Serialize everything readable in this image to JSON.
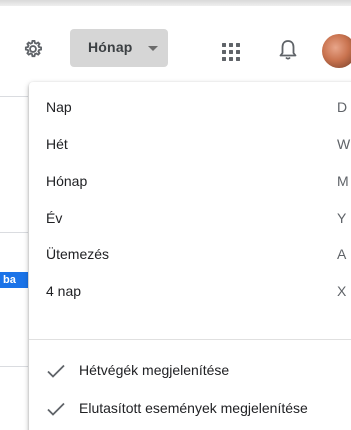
{
  "header": {
    "view_selector_label": "Hónap",
    "icons": [
      "settings-gear-icon",
      "chevron-down-icon",
      "apps-grid-icon",
      "notification-bell-icon",
      "avatar"
    ]
  },
  "background": {
    "event_chip_text": "ba"
  },
  "view_menu": {
    "items": [
      {
        "label": "Nap",
        "shortcut": "D"
      },
      {
        "label": "Hét",
        "shortcut": "W"
      },
      {
        "label": "Hónap",
        "shortcut": "M"
      },
      {
        "label": "Év",
        "shortcut": "Y"
      },
      {
        "label": "Ütemezés",
        "shortcut": "A"
      },
      {
        "label": "4 nap",
        "shortcut": "X"
      }
    ],
    "options": [
      {
        "label": "Hétvégék megjelenítése",
        "checked": true
      },
      {
        "label": "Elutasított események megjelenítése",
        "checked": true
      }
    ]
  },
  "colors": {
    "selector_bg": "#d6d6d6",
    "event_chip": "#1a73e8",
    "check_mark": "#5f6368"
  }
}
